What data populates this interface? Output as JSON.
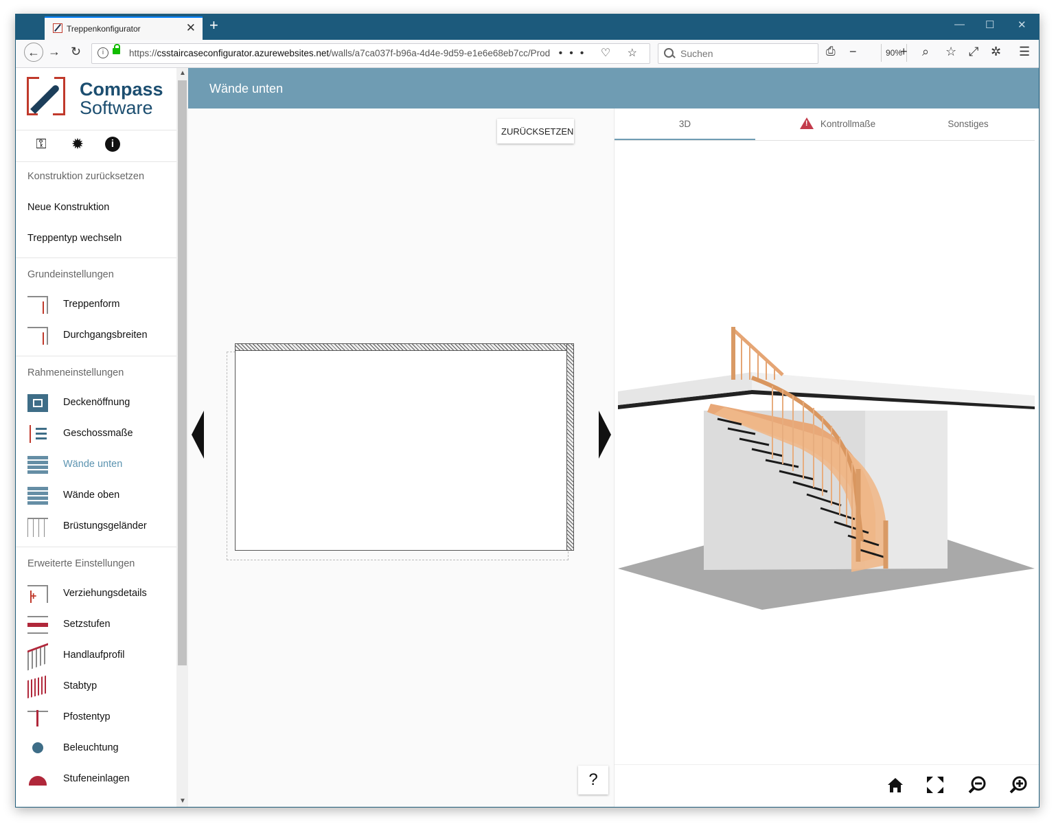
{
  "browser": {
    "tab_title": "Treppenkonfigurator",
    "url_prefix": "https://",
    "url_host": "csstaircaseconfigurator.azurewebsites.net",
    "url_path": "/walls/a7ca037f-b96a-4d4e-9d59-e1e6e68eb7cc/Prod",
    "search_placeholder": "Suchen",
    "zoom": "90%"
  },
  "logo": {
    "line1": "Compass",
    "line2": "Software"
  },
  "sidebar": {
    "actions": [
      "Konstruktion zurücksetzen",
      "Neue Konstruktion",
      "Treppentyp wechseln"
    ],
    "sections": [
      {
        "title": "Grundeinstellungen",
        "items": [
          "Treppenform",
          "Durchgangsbreiten"
        ]
      },
      {
        "title": "Rahmeneinstellungen",
        "items": [
          "Deckenöffnung",
          "Geschossmaße",
          "Wände unten",
          "Wände oben",
          "Brüstungsgeländer"
        ]
      },
      {
        "title": "Erweiterte Einstellungen",
        "items": [
          "Verziehungsdetails",
          "Setzstufen",
          "Handlaufprofil",
          "Stabtyp",
          "Pfostentyp",
          "Beleuchtung",
          "Stufeneinlagen"
        ]
      }
    ],
    "active_item": "Wände unten"
  },
  "header": {
    "title": "Wände unten"
  },
  "editor": {
    "reset_label": "ZURÜCKSETZEN",
    "help_label": "?"
  },
  "tabs": [
    "3D",
    "Kontrollmaße",
    "Sonstiges"
  ],
  "colors": {
    "accent": "#6f9cb3",
    "brand_red": "#c0392b",
    "brand_blue": "#1c4e70",
    "titlebar": "#1c5a7c"
  }
}
